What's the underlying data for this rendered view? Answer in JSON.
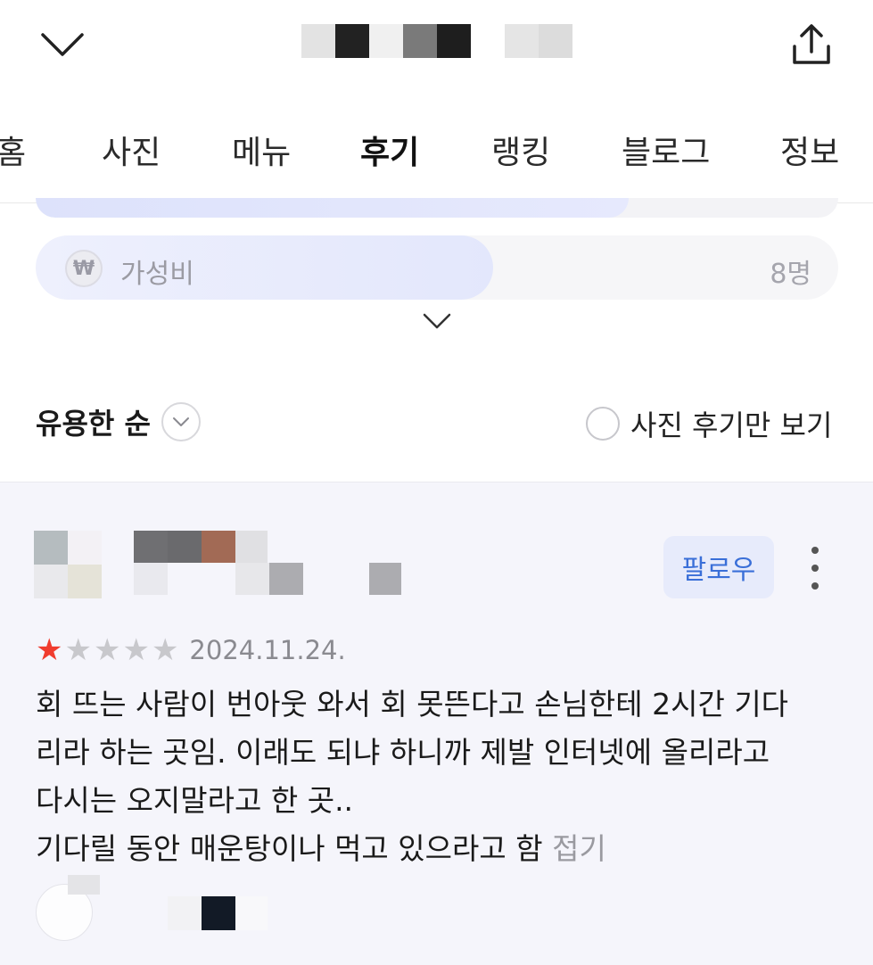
{
  "tabs": [
    {
      "label": "홈"
    },
    {
      "label": "사진"
    },
    {
      "label": "메뉴"
    },
    {
      "label": "후기"
    },
    {
      "label": "랭킹"
    },
    {
      "label": "블로그"
    },
    {
      "label": "정보"
    }
  ],
  "keyword": {
    "icon": "won-icon",
    "icon_glyph": "₩",
    "label": "가성비",
    "count": "8명",
    "fill_fraction": 0.57
  },
  "sort": {
    "label": "유용한 순"
  },
  "photo_filter": {
    "label": "사진 후기만 보기",
    "checked": false
  },
  "review": {
    "follow_label": "팔로우",
    "rating": 1,
    "rating_max": 5,
    "date": "2024.11.24.",
    "text_lines": [
      "회 뜨는 사람이 번아웃 와서 회 못뜬다고 손님한테 2시간 기다",
      "리라 하는 곳임. 이래도 되냐 하니까 제발 인터넷에 올리라고",
      "다시는 오지말라고 한 곳..",
      "기다릴 동안 매운탕이나 먹고 있으라고 함"
    ],
    "fold_label": "접기"
  },
  "colors": {
    "accent_blue": "#3a6fd8",
    "star_red": "#f03c2e",
    "review_bg": "#f5f5fb"
  }
}
